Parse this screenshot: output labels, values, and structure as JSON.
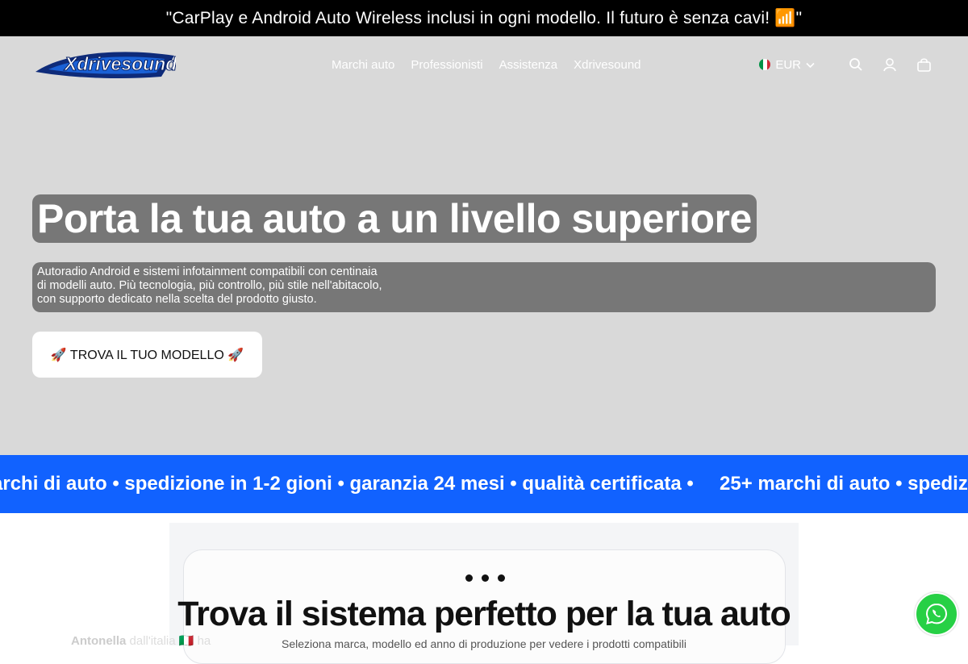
{
  "announcement": {
    "text": "\"CarPlay e Android Auto Wireless inclusi in ogni modello. Il futuro è senza cavi! 📶\""
  },
  "header": {
    "logo_text": "Xdrivesound",
    "nav": [
      {
        "label": "Marchi auto"
      },
      {
        "label": "Professionisti"
      },
      {
        "label": "Assistenza"
      },
      {
        "label": "Xdrivesound"
      }
    ],
    "currency": "EUR"
  },
  "hero": {
    "title": "Porta la tua auto a un livello superiore",
    "subtitle_lines": [
      "Autoradio Android e sistemi infotainment compatibili con centinaia",
      "di modelli auto. Più tecnologia, più controllo, più stile nell'abitacolo,",
      "con supporto dedicato nella scelta del prodotto giusto."
    ],
    "cta_label": "🚀 TROVA IL TUO MODELLO 🚀"
  },
  "ticker": {
    "visible_start": "archi di auto • spedizione in 1-2 gioni • garanzia 24 mesi • qualità certificata •",
    "visible_end": "25+ marchi di auto • spediz"
  },
  "finder": {
    "title": "Trova il sistema perfetto per la tua auto",
    "description": "Seleziona marca, modello ed anno di produzione per vedere i prodotti compatibili"
  },
  "review_popup": {
    "name": "Antonella",
    "text": "dall'italia 🇮🇹 ha"
  },
  "colors": {
    "announcement_bg": "#000000",
    "hero_bg": "#d9d9d9",
    "ticker_bg": "#1162ff",
    "whatsapp": "#27d045"
  }
}
